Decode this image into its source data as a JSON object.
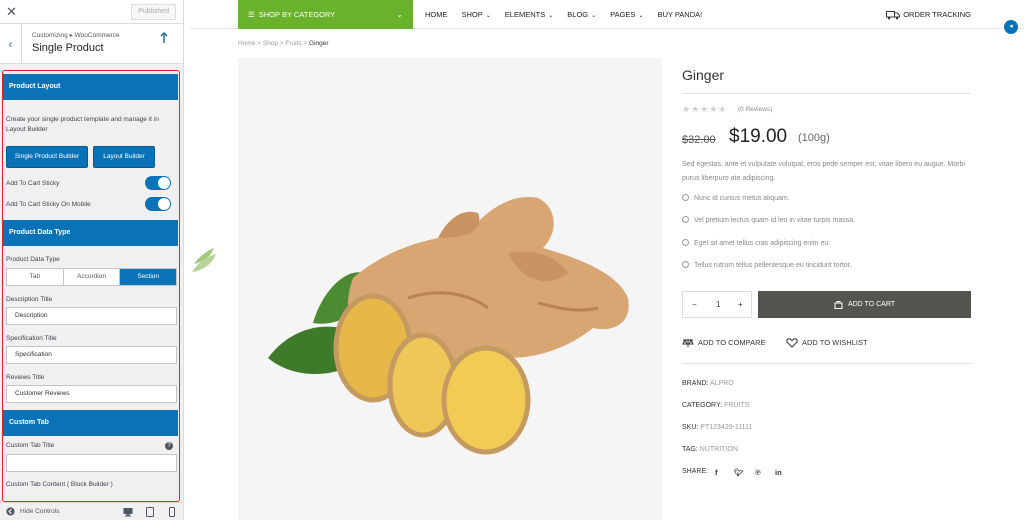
{
  "sidebar": {
    "published_label": "Published",
    "breadcrumb": "Customizing ▸ WooCommerce",
    "title": "Single Product",
    "product_layout": {
      "header": "Product Layout",
      "description": "Create your single product template and manage it in Layout Builder",
      "buttons": [
        "Single Product Builder",
        "Layout Builder"
      ],
      "toggle_1_label": "Add To Cart Sticky",
      "toggle_2_label": "Add To Cart Sticky On Mobile",
      "toggle_1_on": true,
      "toggle_2_on": true
    },
    "product_data_type": {
      "header": "Product Data Type",
      "label": "Product Data Type",
      "options": [
        "Tab",
        "Accordion",
        "Section"
      ],
      "selected": "Section",
      "description_title_label": "Description Title",
      "description_title_value": "Description",
      "specification_title_label": "Specification Title",
      "specification_title_value": "Specification",
      "reviews_title_label": "Reviews Title",
      "reviews_title_value": "Customer Reviews"
    },
    "custom_tab": {
      "header": "Custom Tab",
      "title_label": "Custom Tab Title",
      "title_value": "",
      "content_label": "Custom Tab Content ( Block Builder )"
    },
    "footer": {
      "hide_controls": "Hide Controls"
    }
  },
  "site": {
    "shop_by_category": "SHOP BY CATEGORY",
    "nav": [
      "HOME",
      "SHOP",
      "ELEMENTS",
      "BLOG",
      "PAGES",
      "BUY PANDA!"
    ],
    "order_tracking": "ORDER TRACKING",
    "breadcrumb": [
      "Home",
      "Shop",
      "Fruits",
      "Ginger"
    ]
  },
  "product": {
    "title": "Ginger",
    "rating": 0,
    "reviews": "(0 Reviews)",
    "old_price": "$32.00",
    "price": "$19.00",
    "unit": "(100g)",
    "description": "Sed egestas, ante et vulputate volutpat, eros pede semper est, vitae libero eu augue. Morbi purus liberpuro ate adipiscing.",
    "bullets": [
      "Nunc id cursus metus aliquam.",
      "Vel pretium lectus quam id leo in vitae turpis massa.",
      "Eget sit amet tellus cras adipiscing enim eu.",
      "Tellus rutrum tellus pellentesque eu tincidunt tortor."
    ],
    "quantity": "1",
    "add_to_cart": "ADD TO CART",
    "add_to_compare": "ADD TO COMPARE",
    "add_to_wishlist": "ADD TO WISHLIST",
    "brand_label": "BRAND:",
    "brand": "ALPRO",
    "category_label": "CATEGORY:",
    "category": "FRUITS",
    "sku_label": "SKU:",
    "sku": "PT123429-11111",
    "tag_label": "TAG:",
    "tag": "NUTRITION",
    "share_label": "SHARE:"
  },
  "colors": {
    "accent_blue": "#0a73b8",
    "green": "#6ab12c",
    "frame_red": "#e02424",
    "cart_button": "#555550"
  },
  "icons": {
    "close": "close-icon",
    "back": "chevron-left-icon",
    "help": "help-icon",
    "truck": "truck-icon",
    "cart": "cart-icon",
    "compare": "compare-icon",
    "wishlist": "heart-icon",
    "facebook": "facebook-icon",
    "twitter": "twitter-icon",
    "pinterest": "pinterest-icon",
    "linkedin": "linkedin-icon"
  }
}
